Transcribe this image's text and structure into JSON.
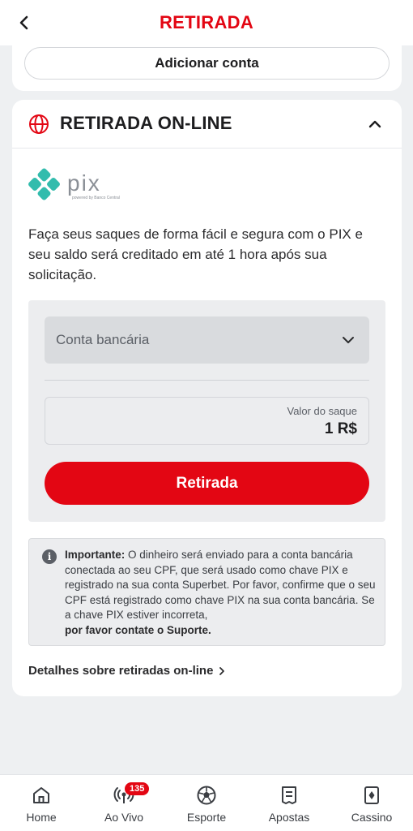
{
  "header": {
    "title": "RETIRADA"
  },
  "top_card": {
    "add_account_label": "Adicionar conta"
  },
  "section": {
    "title": "RETIRADA ON-LINE",
    "pix_logo_text": "pix",
    "pix_logo_caption": "powered by Banco Central",
    "description": "Faça seus saques de forma fácil e segura com o PIX e seu saldo será creditado em até 1 hora após sua solicitação."
  },
  "form": {
    "account_placeholder": "Conta bancária",
    "amount_label": "Valor do saque",
    "amount_value": "1 R$",
    "submit_label": "Retirada"
  },
  "notice": {
    "strong": "Importante:",
    "text": " O dinheiro será enviado para a conta bancária conectada ao seu CPF, que será usado como chave PIX e registrado na sua conta Superbet. Por favor, confirme que o seu CPF está registrado como chave PIX na sua conta bancária. Se a chave PIX estiver incorreta,",
    "support": "por favor contate o Suporte."
  },
  "details_link": "Detalhes sobre retiradas on-line",
  "nav": {
    "items": [
      {
        "label": "Home",
        "icon": "home-icon"
      },
      {
        "label": "Ao Vivo",
        "icon": "live-broadcast-icon",
        "badge": "135"
      },
      {
        "label": "Esporte",
        "icon": "soccer-ball-icon"
      },
      {
        "label": "Apostas",
        "icon": "betslip-icon"
      },
      {
        "label": "Cassino",
        "icon": "playing-card-icon"
      }
    ]
  },
  "colors": {
    "brand": "#e30613",
    "pix": "#32bcad"
  }
}
